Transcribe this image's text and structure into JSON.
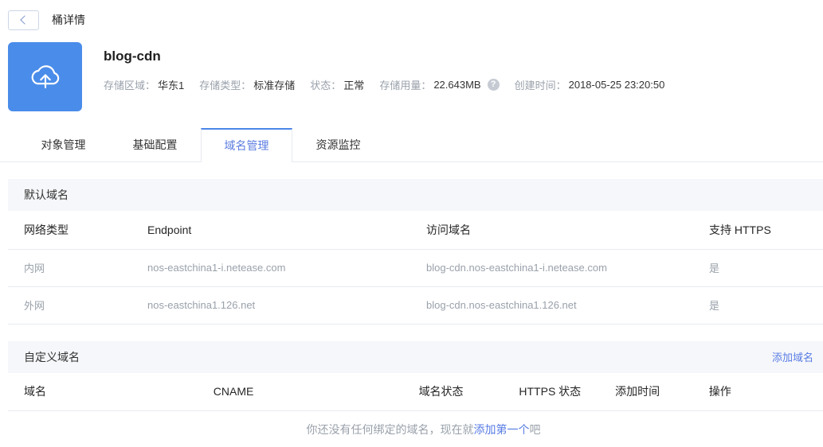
{
  "topbar": {
    "title": "桶详情"
  },
  "icons": {
    "back": "chevron-left",
    "bucket": "cloud-upload",
    "help_glyph": "?"
  },
  "colors": {
    "accent": "#4c87e8",
    "link": "#587ce4",
    "icon-bg": "#4a8cea",
    "text-dark": "#333333",
    "text-gray": "#9aa1ab",
    "border": "#e7eaf0",
    "section-bg": "#f6f7fa"
  },
  "bucket": {
    "name": "blog-cdn",
    "info": [
      {
        "label": "存储区域：",
        "value": "华东1"
      },
      {
        "label": "存储类型：",
        "value": "标准存储"
      },
      {
        "label": "状态：",
        "value": "正常"
      },
      {
        "label": "存储用量：",
        "value": "22.643MB"
      },
      {
        "label": "创建时间：",
        "value": "2018-05-25 23:20:50"
      }
    ]
  },
  "tabs": [
    {
      "label": "对象管理",
      "active": false
    },
    {
      "label": "基础配置",
      "active": false
    },
    {
      "label": "域名管理",
      "active": true
    },
    {
      "label": "资源监控",
      "active": false
    }
  ],
  "default_domain": {
    "section_title": "默认域名",
    "columns": [
      "网络类型",
      "Endpoint",
      "访问域名",
      "支持 HTTPS"
    ],
    "rows": [
      [
        "内网",
        "nos-eastchina1-i.netease.com",
        "blog-cdn.nos-eastchina1-i.netease.com",
        "是"
      ],
      [
        "外网",
        "nos-eastchina1.126.net",
        "blog-cdn.nos-eastchina1.126.net",
        "是"
      ]
    ]
  },
  "custom_domain": {
    "section_title": "自定义域名",
    "add_link": "添加域名",
    "columns": [
      "域名",
      "CNAME",
      "域名状态",
      "HTTPS 状态",
      "添加时间",
      "操作"
    ],
    "empty_state": {
      "prefix": "你还没有任何绑定的域名，现在就",
      "link": "添加第一个",
      "suffix": "吧"
    }
  }
}
